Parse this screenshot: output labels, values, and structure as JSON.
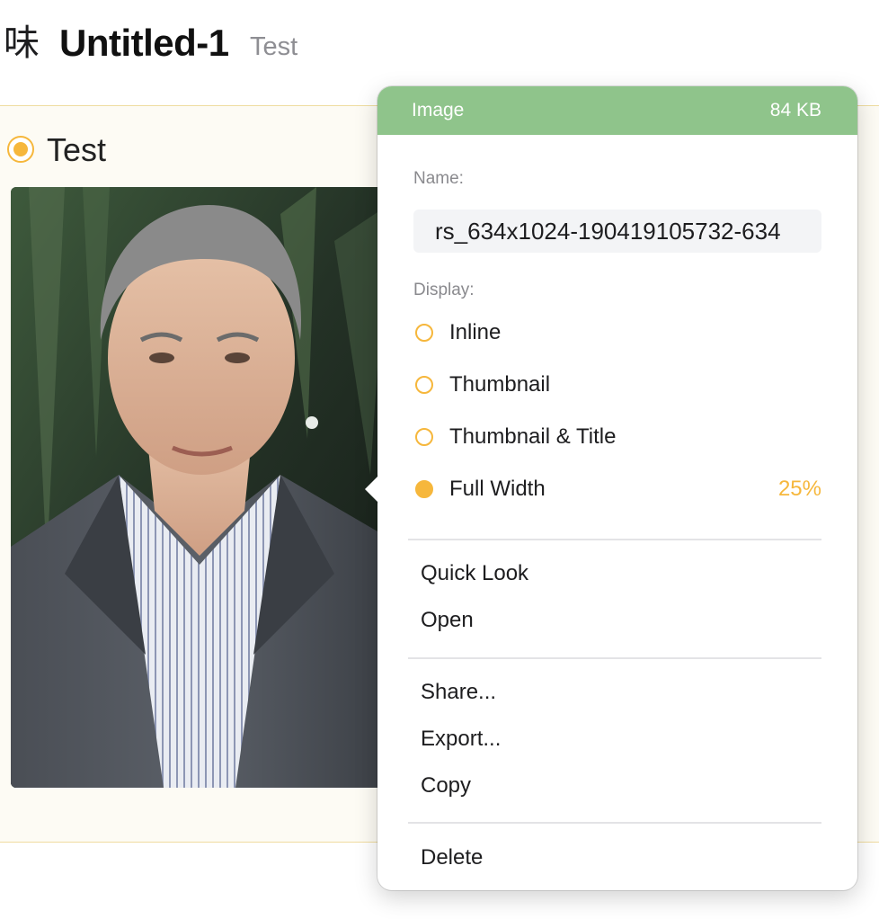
{
  "header": {
    "app_glyph": "味",
    "title": "Untitled-1",
    "subtitle": "Test"
  },
  "note": {
    "title": "Test"
  },
  "popover": {
    "header": {
      "type_label": "Image",
      "size_label": "84 KB",
      "color": "#8fc48b"
    },
    "name_label": "Name:",
    "name_value": "rs_634x1024-190419105732-634",
    "display_label": "Display:",
    "display_options": [
      {
        "label": "Inline",
        "selected": false
      },
      {
        "label": "Thumbnail",
        "selected": false
      },
      {
        "label": "Thumbnail & Title",
        "selected": false
      },
      {
        "label": "Full Width",
        "selected": true,
        "value": "25%"
      }
    ],
    "menu_groups": [
      [
        {
          "label": "Quick Look"
        },
        {
          "label": "Open"
        }
      ],
      [
        {
          "label": "Share..."
        },
        {
          "label": "Export..."
        },
        {
          "label": "Copy"
        }
      ],
      [
        {
          "label": "Delete"
        }
      ]
    ]
  },
  "colors": {
    "accent": "#f6b73c",
    "card_border": "#efdca0",
    "card_bg": "#fdfbf4"
  }
}
